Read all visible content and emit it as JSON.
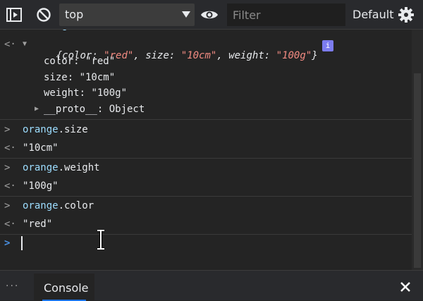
{
  "toolbar": {
    "context": "top",
    "filter_placeholder": "Filter",
    "levels": "Default"
  },
  "console": {
    "obj_preview_open": "{",
    "obj_preview_props": [
      {
        "key": "color",
        "value": "\"red\""
      },
      {
        "key": "size",
        "value": "\"10cm\""
      },
      {
        "key": "weight",
        "value": "\"100g\""
      }
    ],
    "obj_preview_close": "}",
    "obj_props": [
      {
        "key": "color",
        "value": "\"red\""
      },
      {
        "key": "size",
        "value": "\"10cm\""
      },
      {
        "key": "weight",
        "value": "\"100g\""
      }
    ],
    "proto_key": "__proto__",
    "proto_value": "Object",
    "entries": [
      {
        "obj": "orange",
        "prop": ".size",
        "result": "\"10cm\""
      },
      {
        "obj": "orange",
        "prop": ".weight",
        "result": "\"100g\""
      },
      {
        "obj": "orange",
        "prop": ".color",
        "result": "\"red\""
      }
    ],
    "info_badge": "i"
  },
  "drawer": {
    "more": "⋮",
    "tab_label": "Console"
  },
  "colors": {
    "accent": "#1a73e8",
    "string_preview": "#f28b82",
    "keyword_blue": "#9cdcfe"
  }
}
